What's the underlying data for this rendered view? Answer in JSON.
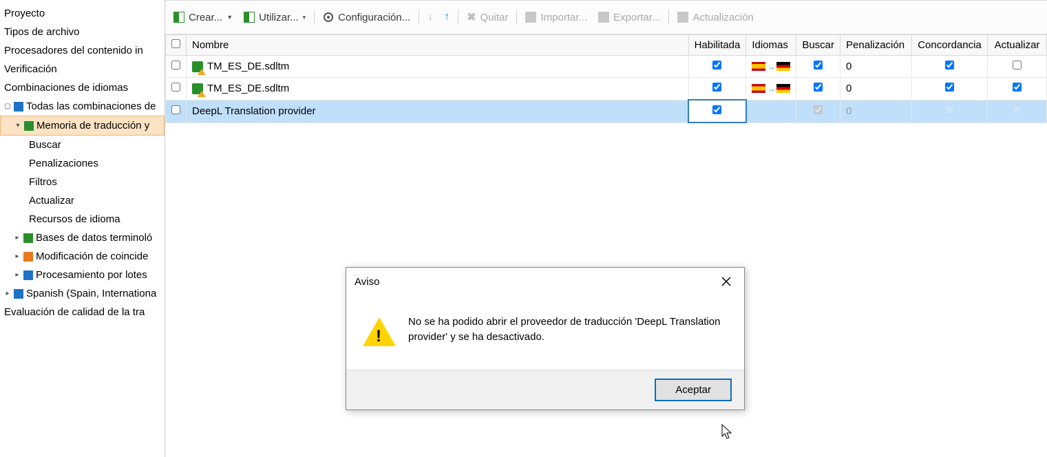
{
  "sidebar": {
    "items": [
      {
        "label": "Proyecto"
      },
      {
        "label": "Tipos de archivo"
      },
      {
        "label": "Procesadores del contenido in"
      },
      {
        "label": "Verificación"
      },
      {
        "label": "Combinaciones de idiomas"
      },
      {
        "label": "Todas las combinaciones de"
      },
      {
        "label": "Memoria de traducción y"
      },
      {
        "label": "Buscar"
      },
      {
        "label": "Penalizaciones"
      },
      {
        "label": "Filtros"
      },
      {
        "label": "Actualizar"
      },
      {
        "label": "Recursos de idioma"
      },
      {
        "label": "Bases de datos terminoló"
      },
      {
        "label": "Modificación de coincide"
      },
      {
        "label": "Procesamiento por lotes"
      },
      {
        "label": "Spanish (Spain, Internationa"
      },
      {
        "label": "Evaluación de calidad de la tra"
      }
    ]
  },
  "toolbar": {
    "create": "Crear...",
    "use": "Utilizar...",
    "config": "Configuración...",
    "remove": "Quitar",
    "import": "Importar...",
    "export": "Exportar...",
    "update": "Actualización"
  },
  "table": {
    "headers": {
      "name": "Nombre",
      "enabled": "Habilitada",
      "languages": "Idiomas",
      "search": "Buscar",
      "penalty": "Penalización",
      "concordance": "Concordancia",
      "update": "Actualizar"
    },
    "rows": [
      {
        "name": "TM_ES_DE.sdltm",
        "penalty": "0",
        "hasFlags": true
      },
      {
        "name": "TM_ES_DE.sdltm",
        "penalty": "0",
        "hasFlags": true
      },
      {
        "name": "DeepL Translation provider",
        "penalty": "0",
        "hasFlags": false
      }
    ]
  },
  "dialog": {
    "title": "Aviso",
    "message": "No se ha podido abrir el proveedor de traducción 'DeepL Translation provider' y se ha desactivado.",
    "ok": "Aceptar"
  }
}
